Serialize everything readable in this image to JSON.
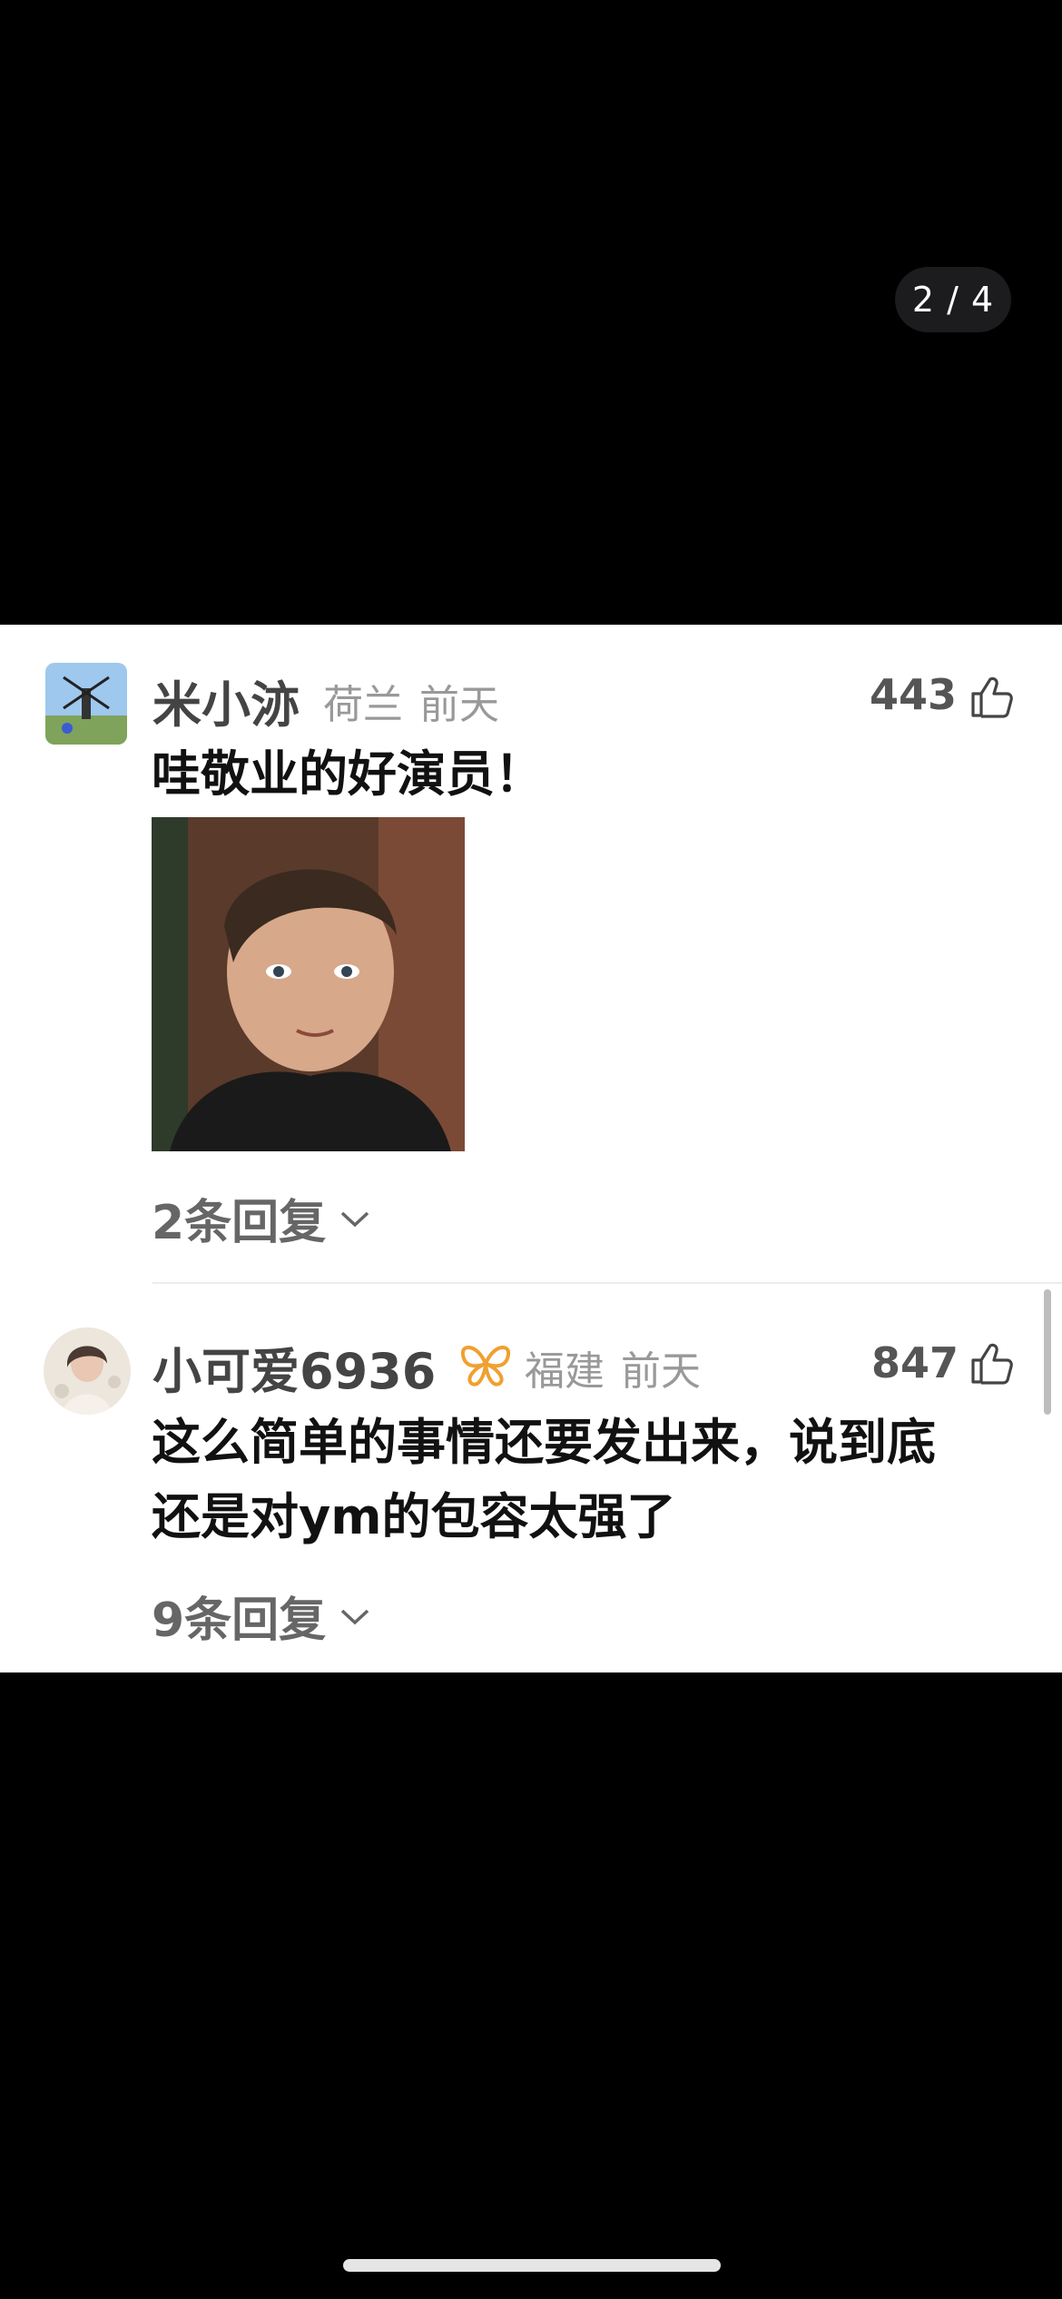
{
  "viewer": {
    "page_indicator": "2 / 4"
  },
  "comments": [
    {
      "author": "米小洂",
      "location": "荷兰",
      "time": "前天",
      "likes": "443",
      "text": "哇敬业的好演员！",
      "replies": "2条回复",
      "has_image": true
    },
    {
      "author": "小可爱6936",
      "location": "福建",
      "time": "前天",
      "likes": "847",
      "text_line1": "这么简单的事情还要发出来，说到底",
      "text_line2": "还是对ym的包容太强了",
      "replies": "9条回复",
      "badge": "butterfly-badge"
    }
  ],
  "colors": {
    "background": "#000000",
    "card": "#ffffff",
    "badge": "#f0a030"
  }
}
